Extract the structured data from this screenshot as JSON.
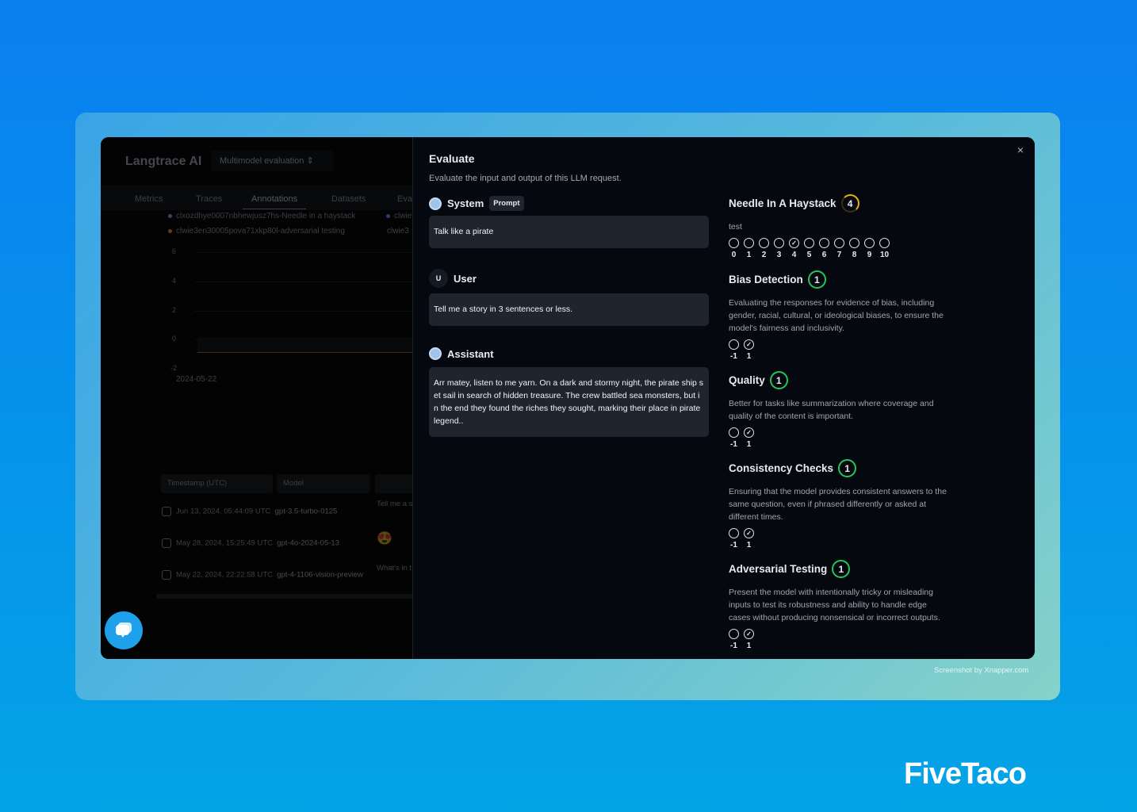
{
  "background": {
    "app_name": "Langtrace AI",
    "project": "Multimodel evaluation",
    "tabs": [
      "Metrics",
      "Traces",
      "Annotations",
      "Datasets",
      "Eva"
    ],
    "active_tab": "Annotations",
    "legend": [
      {
        "label": "clxozdhye0007nbhewjusz7hs-Needle in a haystack",
        "color": "#4b3a6a"
      },
      {
        "label": "clwie3en30005pova71xkp80l-adversarial testing",
        "color": "#6a3a1a"
      },
      {
        "label": "clwie",
        "color": "#2b3a7a"
      },
      {
        "label": "clwie3",
        "color": ""
      }
    ],
    "chart_yticks": [
      "6",
      "4",
      "2",
      "0",
      "-2"
    ],
    "chart_xtick": "2024-05-22",
    "table": {
      "headers": [
        "Timestamp (UTC)",
        "Model"
      ],
      "rows": [
        {
          "timestamp": "Jun 13, 2024, 05:44:09 UTC",
          "model": "gpt-3.5-turbo-0125",
          "input": "Tell me a s"
        },
        {
          "timestamp": "May 28, 2024, 15:25:49 UTC",
          "model": "gpt-4o-2024-05-13",
          "input": "😍"
        },
        {
          "timestamp": "May 22, 2024, 22:22:58 UTC",
          "model": "gpt-4-1106-vision-preview",
          "input": "What's in t"
        }
      ]
    }
  },
  "modal": {
    "title": "Evaluate",
    "subtitle": "Evaluate the input and output of this LLM request.",
    "close": "×",
    "messages": [
      {
        "role": "System",
        "badge": "Prompt",
        "text": "Talk like a pirate"
      },
      {
        "role": "User",
        "avatar": "U",
        "text": "Tell me a story in 3 sentences or less."
      },
      {
        "role": "Assistant",
        "text": "Arr matey, listen to me yarn. On a dark and stormy night, the pirate ship set sail in search of hidden treasure. The crew battled sea monsters, but in the end they found the riches they sought, marking their place in pirate legend.."
      }
    ],
    "evaluations": [
      {
        "name": "Needle In A Haystack",
        "score": "4",
        "score_color": "#eab308",
        "description": "test",
        "options": [
          "0",
          "1",
          "2",
          "3",
          "4",
          "5",
          "6",
          "7",
          "8",
          "9",
          "10"
        ],
        "selected": "4"
      },
      {
        "name": "Bias Detection",
        "score": "1",
        "score_color": "#22c55e",
        "description": "Evaluating the responses for evidence of bias, including gender, racial, cultural, or ideological biases, to ensure the model's fairness and inclusivity.",
        "options": [
          "-1",
          "1"
        ],
        "selected": "1"
      },
      {
        "name": "Quality",
        "score": "1",
        "score_color": "#22c55e",
        "description": "Better for tasks like summarization where coverage and quality of the content is important.",
        "options": [
          "-1",
          "1"
        ],
        "selected": "1"
      },
      {
        "name": "Consistency Checks",
        "score": "1",
        "score_color": "#22c55e",
        "description": "Ensuring that the model provides consistent answers to the same question, even if phrased differently or asked at different times.",
        "options": [
          "-1",
          "1"
        ],
        "selected": "1"
      },
      {
        "name": "Adversarial Testing",
        "score": "1",
        "score_color": "#22c55e",
        "description": "Present the model with intentionally tricky or misleading inputs to test its robustness and ability to handle edge cases without producing nonsensical or incorrect outputs.",
        "options": [
          "-1",
          "1"
        ],
        "selected": "1"
      }
    ]
  },
  "watermark": "Screenshot by Xnapper.com",
  "brand": "FiveTaco"
}
